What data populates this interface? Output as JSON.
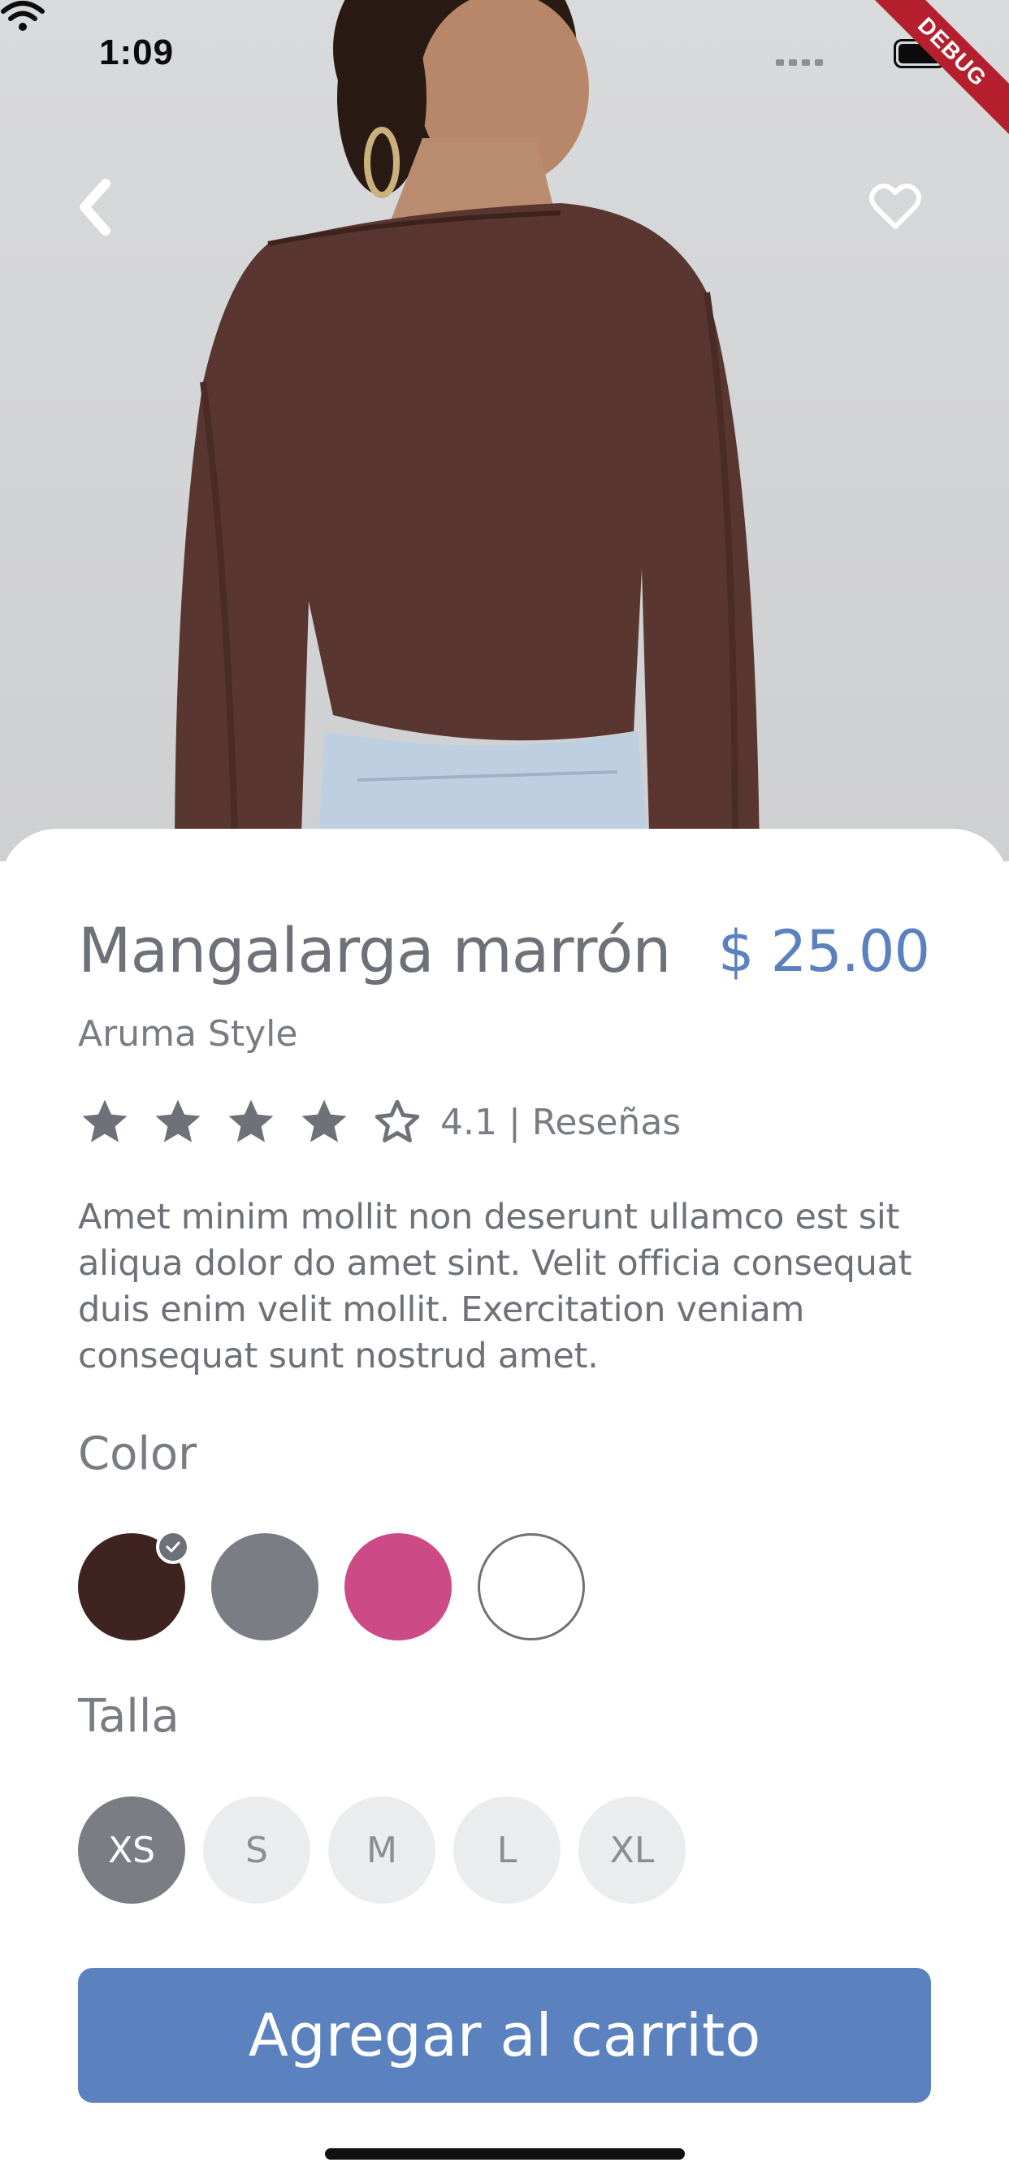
{
  "status_bar": {
    "time": "1:09",
    "debug_label": "DEBUG"
  },
  "hero": {
    "back_icon": "chevron-left-icon",
    "favorite_icon": "heart-outline-icon"
  },
  "product": {
    "title": "Mangalarga marrón",
    "price": "$ 25.00",
    "brand": "Aruma Style",
    "rating": {
      "value": 4.1,
      "max": 5,
      "text": "4.1 | Reseñas"
    },
    "description": "Amet minim mollit non deserunt ullamco est sit aliqua dolor do amet sint. Velit officia consequat duis enim velit mollit. Exercitation veniam consequat sunt nostrud amet."
  },
  "color_section": {
    "label": "Color",
    "options": [
      {
        "name": "brown",
        "hex": "#3f2320",
        "selected": true
      },
      {
        "name": "gray",
        "hex": "#7b7d85",
        "selected": false
      },
      {
        "name": "pink",
        "hex": "#cc4b87",
        "selected": false
      },
      {
        "name": "white",
        "hex": "#ffffff",
        "selected": false
      }
    ]
  },
  "size_section": {
    "label": "Talla",
    "options": [
      {
        "label": "XS",
        "selected": true
      },
      {
        "label": "S",
        "selected": false
      },
      {
        "label": "M",
        "selected": false
      },
      {
        "label": "L",
        "selected": false
      },
      {
        "label": "XL",
        "selected": false
      }
    ]
  },
  "cta": {
    "label": "Agregar al carrito"
  },
  "colors": {
    "accent": "#5b82bf",
    "text": "#6f7179"
  }
}
